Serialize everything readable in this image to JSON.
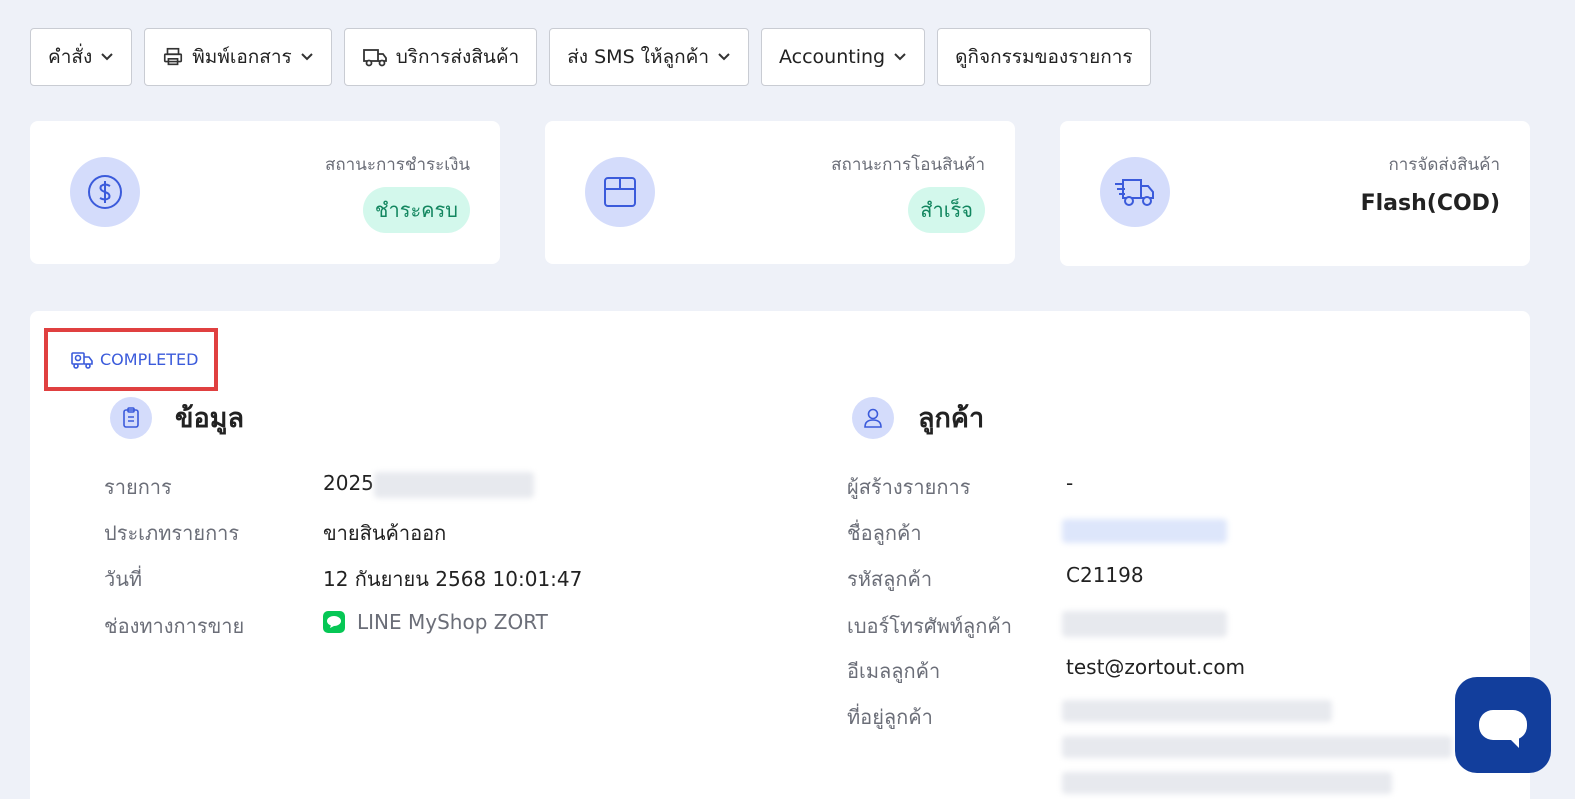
{
  "toolbar": {
    "command_label": "คำสั่ง",
    "print_label": "พิมพ์เอกสาร",
    "shipping_service_label": "บริการส่งสินค้า",
    "sms_label": "ส่ง SMS ให้ลูกค้า",
    "accounting_label": "Accounting",
    "activity_label": "ดูกิจกรรมของรายการ"
  },
  "cards": {
    "payment": {
      "title": "สถานะการชำระเงิน",
      "value": "ชำระครบ"
    },
    "transfer": {
      "title": "สถานะการโอนสินค้า",
      "value": "สำเร็จ"
    },
    "delivery": {
      "title": "การจัดส่งสินค้า",
      "value": "Flash(COD)"
    }
  },
  "status_badge": "COMPLETED",
  "info": {
    "title": "ข้อมูล",
    "rows": [
      {
        "label": "รายการ",
        "value": "2025"
      },
      {
        "label": "ประเภทรายการ",
        "value": "ขายสินค้าออก"
      },
      {
        "label": "วันที่",
        "value": "12 กันยายน 2568 10:01:47"
      },
      {
        "label": "ช่องทางการขาย",
        "value": "LINE MyShop ZORT"
      }
    ]
  },
  "customer": {
    "title": "ลูกค้า",
    "rows": [
      {
        "label": "ผู้สร้างรายการ",
        "value": "-"
      },
      {
        "label": "ชื่อลูกค้า",
        "value": ""
      },
      {
        "label": "รหัสลูกค้า",
        "value": "C21198"
      },
      {
        "label": "เบอร์โทรศัพท์ลูกค้า",
        "value": ""
      },
      {
        "label": "อีเมลลูกค้า",
        "value": "test@zortout.com"
      },
      {
        "label": "ที่อยู่ลูกค้า",
        "value": ""
      }
    ]
  },
  "colors": {
    "accent": "#3b5bdb",
    "icon_bg": "#d4dcfb",
    "success_bg": "#d3f8ec",
    "success_text": "#12865f",
    "highlight_border": "#e04040",
    "chat_button": "#123e9c"
  },
  "icons": {
    "print": "printer-icon",
    "shipping": "truck-icon",
    "payment": "dollar-circle-icon",
    "transfer": "box-icon",
    "delivery": "fast-truck-icon",
    "status": "delivery-van-icon",
    "info": "clipboard-icon",
    "customer": "user-icon",
    "channel": "line-icon",
    "chat": "chat-bubble-icon"
  }
}
